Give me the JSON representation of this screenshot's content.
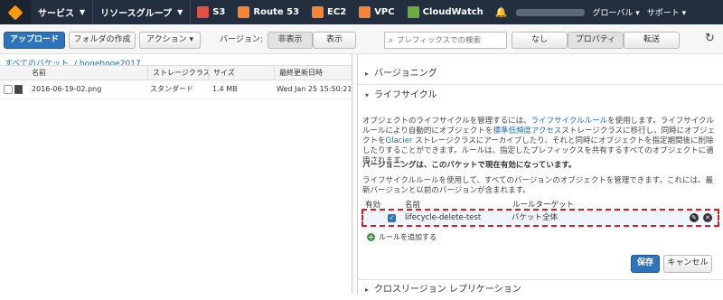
{
  "topnav": {
    "services": "サービス",
    "resource_groups": "リソースグループ",
    "pins": [
      {
        "label": "S3",
        "icon": "s3-icon",
        "color": "#e05243"
      },
      {
        "label": "Route 53",
        "icon": "route53-icon",
        "color": "#f58534"
      },
      {
        "label": "EC2",
        "icon": "ec2-icon",
        "color": "#f58534"
      },
      {
        "label": "VPC",
        "icon": "vpc-icon",
        "color": "#f58534"
      },
      {
        "label": "CloudWatch",
        "icon": "cloudwatch-icon",
        "color": "#6cae3e"
      }
    ],
    "region": "グローバル",
    "support": "サポート"
  },
  "toolbar": {
    "upload": "アップロード",
    "create_folder": "フォルダの作成",
    "actions": "アクション",
    "version_label": "バージョン:",
    "hide": "非表示",
    "show": "表示",
    "search_placeholder": "プレフィックスでの検索",
    "none": "なし",
    "properties": "プロパティ",
    "transfer": "転送"
  },
  "breadcrumb": {
    "all_buckets": "すべてのバケット",
    "bucket": "/ hogehoge2017"
  },
  "file_table": {
    "headers": [
      "名前",
      "ストレージクラス",
      "サイズ",
      "最終更新日時"
    ],
    "rows": [
      {
        "name": "2016-06-19-02.png",
        "storage": "スタンダード",
        "size": "1.4 MB",
        "modified": "Wed Jan 25 15:50:21 G"
      }
    ]
  },
  "properties": {
    "versioning": "バージョニング",
    "lifecycle": "ライフサイクル",
    "desc_1": "オブジェクトのライフサイクルを管理するには、",
    "desc_link1": "ライフサイクルルール",
    "desc_2": "を使用します。ライフサイクルルールにより自動的にオブジェクトを",
    "desc_link2": "標準低頻度アクセス",
    "desc_3": "ストレージクラスに移行し、同時にオブジェクトを",
    "desc_link3": "Glacier",
    "desc_4": " ストレージクラスにアーカイブしたり、それと同時にオブジェクトを指定期間後に削除したりすることができます。ルールは、指定したプレフィックスを共有するすべてのオブジェクトに適用されます。",
    "versioning_enabled": "バージョニングは、このバケットで現在有効になっています。",
    "version_desc": "ライフサイクルルールを使用して、すべてのバージョンのオブジェクトを管理できます。これには、最新バージョンと以前のバージョンが含まれます。",
    "rule_headers": {
      "enabled": "有効",
      "name": "名前",
      "target": "ルールターゲット"
    },
    "rule": {
      "name": "lifecycle-delete-test",
      "target": "バケット全体",
      "enabled": true
    },
    "add_rule": "ルールを追加する",
    "save": "保存",
    "cancel": "キャンセル",
    "cross_region": "クロスリージョン レプリケーション"
  }
}
